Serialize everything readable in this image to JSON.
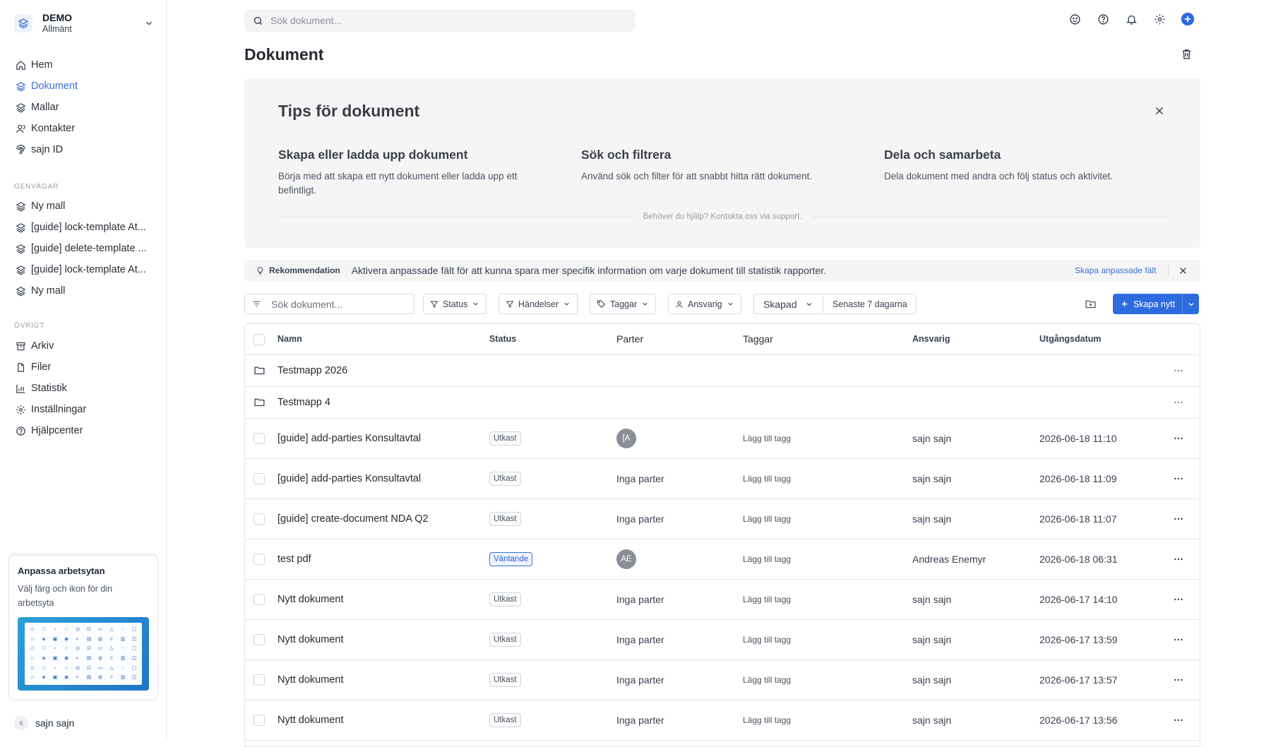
{
  "workspace": {
    "name": "DEMO",
    "sub": "Allmänt"
  },
  "nav": [
    {
      "label": "Hem",
      "icon": "home-icon"
    },
    {
      "label": "Dokument",
      "icon": "document-stack-icon",
      "active": true
    },
    {
      "label": "Mallar",
      "icon": "layers-icon"
    },
    {
      "label": "Kontakter",
      "icon": "contacts-icon"
    },
    {
      "label": "sajn ID",
      "icon": "fingerprint-icon"
    }
  ],
  "shortcuts_label": "GENVÄGAR",
  "shortcuts": [
    {
      "label": "Ny mall"
    },
    {
      "label": "[guide] lock-template At..."
    },
    {
      "label": "[guide] delete-template ..."
    },
    {
      "label": "[guide] lock-template At..."
    },
    {
      "label": "Ny mall"
    }
  ],
  "other_label": "ÖVRIGT",
  "other": [
    {
      "label": "Arkiv",
      "icon": "archive-icon"
    },
    {
      "label": "Filer",
      "icon": "file-icon"
    },
    {
      "label": "Statistik",
      "icon": "bar-chart-icon"
    },
    {
      "label": "Inställningar",
      "icon": "gear-icon"
    },
    {
      "label": "Hjälpcenter",
      "icon": "help-icon"
    }
  ],
  "customize": {
    "title": "Anpassa arbetsytan",
    "text": "Välj färg och ikon för din arbetsyta"
  },
  "user": {
    "initial": "s",
    "name": "sajn sajn"
  },
  "topbar": {
    "search_placeholder": "Sök dokument..."
  },
  "page": {
    "title": "Dokument"
  },
  "tips": {
    "title": "Tips för dokument",
    "columns": [
      {
        "title": "Skapa eller ladda upp dokument",
        "text": "Börja med att skapa ett nytt dokument eller ladda upp ett befintligt."
      },
      {
        "title": "Sök och filtrera",
        "text": "Använd sök och filter för att snabbt hitta rätt dokument."
      },
      {
        "title": "Dela och samarbeta",
        "text": "Dela dokument med andra och följ status och aktivitet."
      }
    ],
    "support": "Behöver du hjälp? Kontakta oss via support."
  },
  "recommendation": {
    "label": "Rekommendation",
    "text": "Aktivera anpassade fält för att kunna spara mer specifik information om varje dokument till statistik rapporter.",
    "link": "Skapa anpassade fält"
  },
  "filters": {
    "search_placeholder": "Sök dokument...",
    "status": "Status",
    "events": "Händelser",
    "tags": "Taggar",
    "owner": "Ansvarig",
    "created": "Skapad",
    "range": "Senaste 7 dagarna",
    "create": "Skapa nytt"
  },
  "table": {
    "headers": {
      "name": "Namn",
      "status": "Status",
      "parties": "Parter",
      "tags": "Taggar",
      "owner": "Ansvarig",
      "expiry": "Utgångsdatum"
    },
    "folders": [
      {
        "name": "Testmapp 2026"
      },
      {
        "name": "Testmapp 4"
      }
    ],
    "rows": [
      {
        "name": "[guide] add-parties Konsultavtal",
        "status": "Utkast",
        "parties": "[A",
        "party_avatar": true,
        "tag": "Lägg till tagg",
        "owner": "sajn sajn",
        "date": "2026-06-18 11:10"
      },
      {
        "name": "[guide] add-parties Konsultavtal",
        "status": "Utkast",
        "parties": "Inga parter",
        "party_avatar": false,
        "tag": "Lägg till tagg",
        "owner": "sajn sajn",
        "date": "2026-06-18 11:09"
      },
      {
        "name": "[guide] create-document NDA Q2",
        "status": "Utkast",
        "parties": "Inga parter",
        "party_avatar": false,
        "tag": "Lägg till tagg",
        "owner": "sajn sajn",
        "date": "2026-06-18 11:07"
      },
      {
        "name": "test pdf",
        "status": "Väntande",
        "status_pending": true,
        "parties": "AE",
        "party_avatar": true,
        "tag": "Lägg till tagg",
        "owner": "Andreas Enemyr",
        "date": "2026-06-18 06:31"
      },
      {
        "name": "Nytt dokument",
        "status": "Utkast",
        "parties": "Inga parter",
        "party_avatar": false,
        "tag": "Lägg till tagg",
        "owner": "sajn sajn",
        "date": "2026-06-17 14:10"
      },
      {
        "name": "Nytt dokument",
        "status": "Utkast",
        "parties": "Inga parter",
        "party_avatar": false,
        "tag": "Lägg till tagg",
        "owner": "sajn sajn",
        "date": "2026-06-17 13:59"
      },
      {
        "name": "Nytt dokument",
        "status": "Utkast",
        "parties": "Inga parter",
        "party_avatar": false,
        "tag": "Lägg till tagg",
        "owner": "sajn sajn",
        "date": "2026-06-17 13:57"
      },
      {
        "name": "Nytt dokument",
        "status": "Utkast",
        "parties": "Inga parter",
        "party_avatar": false,
        "tag": "Lägg till tagg",
        "owner": "sajn sajn",
        "date": "2026-06-17 13:56"
      }
    ]
  },
  "colors": {
    "accent": "#3b6ed9",
    "primary_button": "#2d6cdf"
  }
}
